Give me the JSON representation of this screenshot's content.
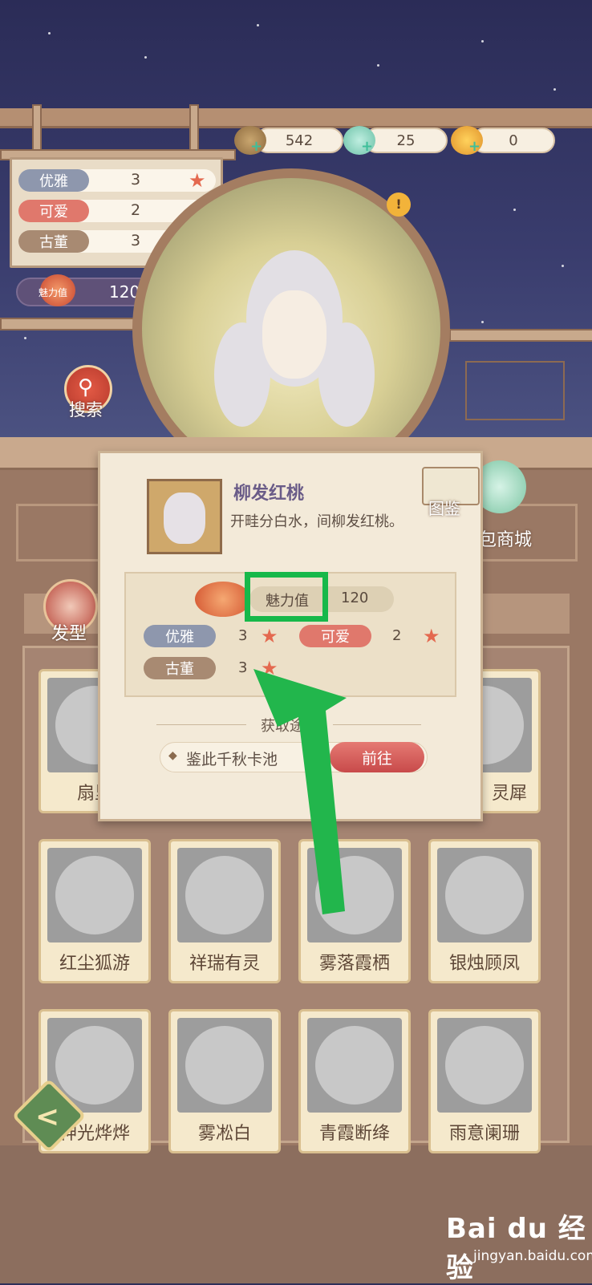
{
  "currency": {
    "coins": "542",
    "jade": "25",
    "gold": "0"
  },
  "stats": [
    {
      "label": "优雅",
      "value": "3",
      "color": "#8e97ad"
    },
    {
      "label": "可爱",
      "value": "2",
      "color": "#e0786c"
    },
    {
      "label": "古董",
      "value": "3",
      "color": "#a88a72"
    }
  ],
  "charm": {
    "label": "魅力值",
    "value": "120"
  },
  "buttons": {
    "search": "搜索",
    "tujian": "图鉴",
    "shop": "包商城",
    "fashion": "发型"
  },
  "popup": {
    "item_name": "柳发红桃",
    "item_desc": "开畦分白水，间柳发红桃。",
    "charm_label": "魅力值",
    "charm_value": "120",
    "stats": [
      {
        "label": "优雅",
        "value": "3"
      },
      {
        "label": "可爱",
        "value": "2"
      },
      {
        "label": "古董",
        "value": "3"
      }
    ],
    "source_title": "获取途径",
    "source_name": "鉴此千秋卡池",
    "go_label": "前往"
  },
  "cards": {
    "row1": [
      "扇里",
      "灵犀"
    ],
    "row2": [
      "红尘狐游",
      "祥瑞有灵",
      "雾落霞栖",
      "银烛顾凤"
    ],
    "row3": [
      "神光烨烨",
      "雾凇白",
      "青霞断绛",
      "雨意阑珊"
    ]
  },
  "watermark": {
    "brand": "Bai du 经验",
    "url": "jingyan.baidu.com"
  },
  "colors": {
    "highlight": "#17b84a",
    "arrow": "#22b64c"
  }
}
